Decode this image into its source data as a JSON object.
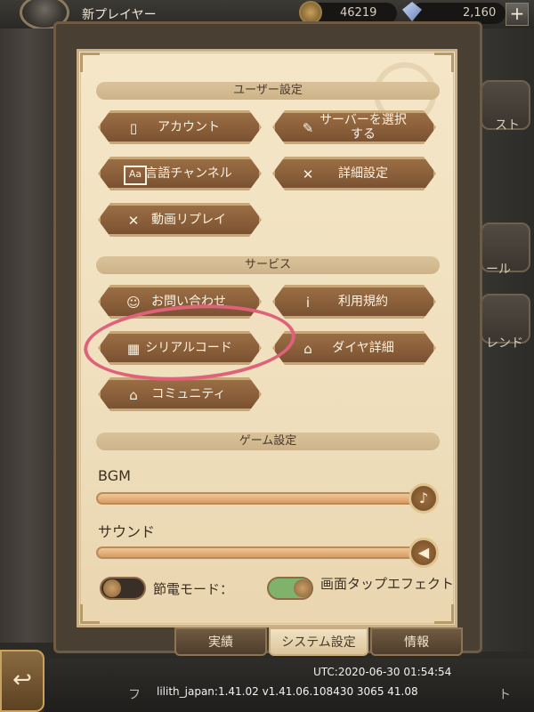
{
  "header": {
    "player_name": "新プレイヤー",
    "coins": "46219",
    "gems": "2,160",
    "plus_label": "+"
  },
  "side": {
    "label_1": "スト",
    "label_2": "ール",
    "label_3": "レンド"
  },
  "sections": {
    "user": "ユーザー設定",
    "service": "サービス",
    "game": "ゲーム設定"
  },
  "buttons": {
    "account": "アカウント",
    "server_line1": "サーバーを選択",
    "server_line2": "する",
    "language": "言語チャンネル",
    "details": "詳細設定",
    "replay": "動画リプレイ",
    "contact": "お問い合わせ",
    "terms": "利用規約",
    "serial": "シリアルコード",
    "diamond": "ダイヤ詳細",
    "community": "コミュニティ"
  },
  "game_settings": {
    "bgm_label": "BGM",
    "bgm_level": 1.0,
    "sound_label": "サウンド",
    "sound_level": 1.0,
    "power_saving_label": "節電モード：",
    "power_saving_on": false,
    "tap_effect_label": "画面タップエフェクト",
    "tap_effect_on": true
  },
  "tabs": {
    "achievements": "実績",
    "system": "システム設定",
    "info": "情報"
  },
  "footer": {
    "utc": "UTC:2020-06-30 01:54:54",
    "version": "lilith_japan:1.41.02  v1.41.06.108430 3065 41.08",
    "bg_left": "フ",
    "bg_right": "ト"
  },
  "colors": {
    "parchment": "#f0e0bf",
    "button": "#8a6039",
    "annotation": "#e0627a",
    "toggle_on": "#7fb26a"
  },
  "icons": {
    "account": "phone-icon",
    "server": "map-icon",
    "language": "text-icon",
    "details": "tools-icon",
    "replay": "tools-icon",
    "contact": "headset-icon",
    "terms": "info-icon",
    "serial": "gift-icon",
    "diamond": "home-icon",
    "community": "home-icon"
  }
}
